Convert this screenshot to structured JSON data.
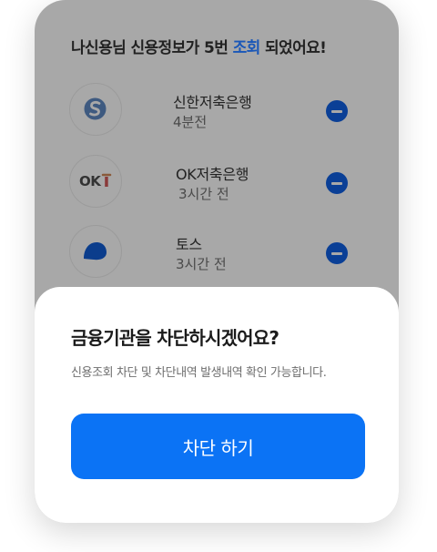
{
  "header": {
    "title_prefix": "나신용님 신용정보가 5번 ",
    "title_highlight": "조회",
    "title_suffix": " 되었어요!"
  },
  "inquiries": [
    {
      "name": "신한저축은행",
      "time": "4분전",
      "logo": "shinhan-logo-icon"
    },
    {
      "name": "OK저축은행",
      "time": "3시간 전",
      "logo": "ok-logo-icon",
      "logo_text": "OK"
    },
    {
      "name": "토스",
      "time": "3시간 전",
      "logo": "toss-logo-icon"
    }
  ],
  "sheet": {
    "title": "금융기관을 차단하시겠어요?",
    "description": "신용조회 차단 및 차단내역 발생내역 확인 가능합니다.",
    "button_label": "차단 하기"
  },
  "colors": {
    "accent": "#0b73f5",
    "remove_button": "#0a3f96",
    "highlight_text": "#1a57b8",
    "dim_overlay": "#a8a8a8"
  }
}
